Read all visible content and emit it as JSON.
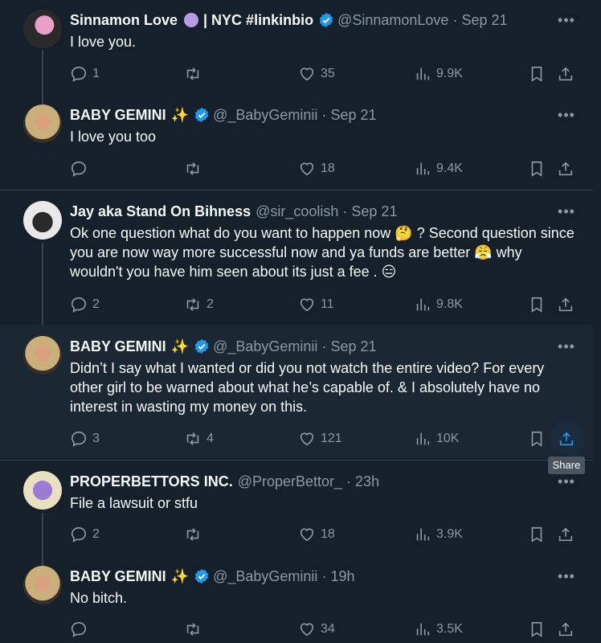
{
  "colors": {
    "background": "#15202b",
    "text": "#f7f9f9",
    "muted": "#8b98a5",
    "verified": "#1d9bf0",
    "divider": "#38444d"
  },
  "tweets": [
    {
      "name": "Sinnamon Love",
      "badge": "| NYC #linkinbio",
      "handle": "@SinnamonLove",
      "date": "Sep 21",
      "text": "I love you.",
      "replies": "1",
      "retweets": "",
      "likes": "35",
      "views": "9.9K"
    },
    {
      "name": "BABY GEMINI",
      "sparkle": "✨",
      "handle": "@_BabyGeminii",
      "date": "Sep 21",
      "text": "I love you too",
      "replies": "",
      "retweets": "",
      "likes": "18",
      "views": "9.4K"
    },
    {
      "name": "Jay aka Stand On Bihness",
      "handle": "@sir_coolish",
      "date": "Sep 21",
      "text": "Ok one question what do you want to happen now 🤔 ? Second question since you are now way more successful now and ya funds are better 😤 why wouldn't you have him seen about its just a fee . 😑",
      "replies": "2",
      "retweets": "2",
      "likes": "11",
      "views": "9.8K"
    },
    {
      "name": "BABY GEMINI",
      "sparkle": "✨",
      "handle": "@_BabyGeminii",
      "date": "Sep 21",
      "text": "Didn’t I say what I wanted or did you not watch the entire video? For every other girl to be warned about what he’s capable of. & I absolutely have no interest in wasting my money on this.",
      "replies": "3",
      "retweets": "4",
      "likes": "121",
      "views": "10K"
    },
    {
      "name": "PROPERBETTORS INC.",
      "handle": "@ProperBettor_",
      "date": "23h",
      "text": "File a lawsuit or stfu",
      "replies": "2",
      "retweets": "",
      "likes": "18",
      "views": "3.9K"
    },
    {
      "name": "BABY GEMINI",
      "sparkle": "✨",
      "handle": "@_BabyGeminii",
      "date": "19h",
      "text": "No bitch.",
      "replies": "",
      "retweets": "",
      "likes": "34",
      "views": "3.5K"
    }
  ],
  "tooltip": "Share"
}
